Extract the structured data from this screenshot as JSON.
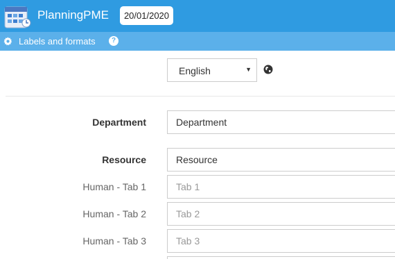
{
  "header": {
    "app_title": "PlanningPME",
    "date": "20/01/2020",
    "logo_icon": "planningpme-logo-icon"
  },
  "subheader": {
    "title": "Labels and formats",
    "settings_icon": "gear-icon",
    "help_icon": "help-icon",
    "help_glyph": "?"
  },
  "language": {
    "selected": "English",
    "caret": "▼",
    "globe_icon": "globe-icon"
  },
  "fields": {
    "department": {
      "label": "Department",
      "value": "Department"
    },
    "resource": {
      "label": "Resource",
      "value": "Resource"
    },
    "human_tab1": {
      "label": "Human - Tab 1",
      "placeholder": "Tab 1"
    },
    "human_tab2": {
      "label": "Human - Tab 2",
      "placeholder": "Tab 2"
    },
    "human_tab3": {
      "label": "Human - Tab 3",
      "placeholder": "Tab 3"
    }
  },
  "colors": {
    "header": "#2f9be1",
    "subheader": "#5bb0ea"
  }
}
